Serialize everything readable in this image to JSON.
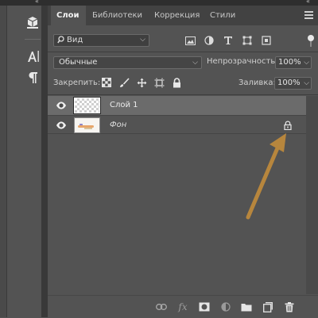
{
  "tabs": [
    {
      "label": "Слои",
      "active": true
    },
    {
      "label": "Библиотеки",
      "active": false
    },
    {
      "label": "Коррекция",
      "active": false
    },
    {
      "label": "Стили",
      "active": false
    }
  ],
  "filter": {
    "search_value": "Вид"
  },
  "blend": {
    "mode": "Обычные",
    "opacity_label": "Непрозрачность:",
    "opacity_value": "100%"
  },
  "lock": {
    "label": "Закрепить:",
    "fill_label": "Заливка:",
    "fill_value": "100%"
  },
  "layers": [
    {
      "name": "Слой 1",
      "selected": true,
      "locked": false
    },
    {
      "name": "Фон",
      "selected": false,
      "locked": true
    }
  ],
  "bottom_icons": [
    "link-icon",
    "fx-icon",
    "mask-icon",
    "adjustment-icon",
    "folder-icon",
    "new-layer-icon",
    "trash-icon"
  ],
  "bottom": {
    "fx_label": "fx"
  },
  "colors": {
    "panel": "#535353",
    "tabbar": "#424242",
    "selected_row": "#6b6b6b",
    "annotation_arrow": "#b7863d"
  }
}
